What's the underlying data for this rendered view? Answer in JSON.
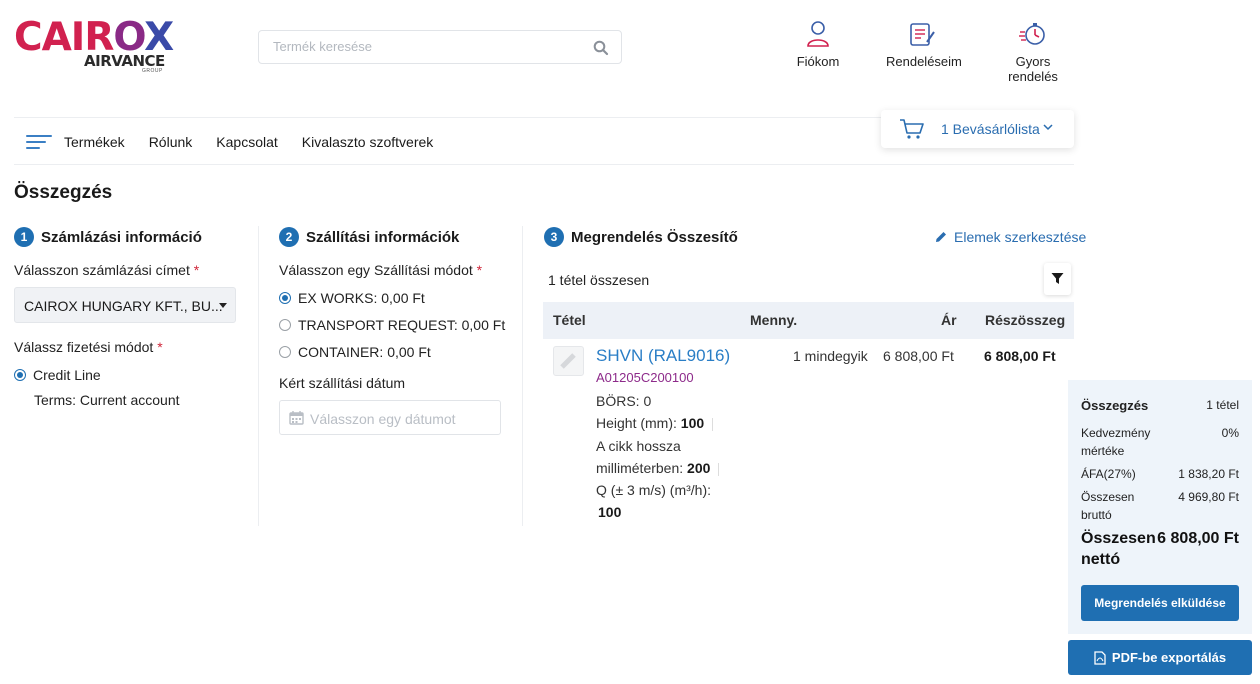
{
  "brand": {
    "name_part1": "CAIR",
    "name_part2": "O",
    "name_part3": "X",
    "sub": "AIRVANCE",
    "group": "GROUP"
  },
  "search": {
    "placeholder": "Termék keresése"
  },
  "header_links": {
    "account": "Fiókom",
    "orders": "Rendeléseim",
    "quick_order": "Gyors rendelés"
  },
  "nav": {
    "items": [
      "Termékek",
      "Rólunk",
      "Kapcsolat",
      "Kivalaszto szoftverek"
    ]
  },
  "cart": {
    "label": "1 Bevásárlólista"
  },
  "page_title": "Összegzés",
  "billing": {
    "step": "1",
    "title": "Számlázási információ",
    "address_label": "Válasszon számlázási címet",
    "address_value": "CAIROX HUNGARY KFT., BU...",
    "payment_label": "Válassz fizetési módot",
    "payment_option": "Credit Line",
    "payment_terms": "Terms: Current account"
  },
  "shipping": {
    "step": "2",
    "title": "Szállítási információk",
    "method_label": "Válasszon egy Szállítási módot",
    "options": [
      "EX WORKS: 0,00 Ft",
      "TRANSPORT REQUEST: 0,00 Ft",
      "CONTAINER: 0,00 Ft"
    ],
    "selected_index": 0,
    "date_label": "Kért szállítási dátum",
    "date_placeholder": "Válasszon egy dátumot"
  },
  "order": {
    "step": "3",
    "title": "Megrendelés Összesítő",
    "edit_link": "Elemek szerkesztése",
    "count_text": "1 tétel összesen",
    "columns": {
      "item": "Tétel",
      "qty": "Menny.",
      "price": "Ár",
      "subtotal": "Részösszeg"
    },
    "items": [
      {
        "name": "SHVN (RAL9016)",
        "code": "A01205C200100",
        "attr1": "BÖRS: 0",
        "attr2_label": "Height (mm):",
        "attr2_value": "100",
        "attr3_label_a": "A cikk hossza",
        "attr3_label_b": "milliméterben:",
        "attr3_value": "200",
        "attr4_label": "Q (± 3 m/s) (m³/h):",
        "attr4_value": "100",
        "qty": "1 mindegyik",
        "price": "6 808,00 Ft",
        "subtotal": "6 808,00 Ft"
      }
    ]
  },
  "summary": {
    "title": "Összegzés",
    "count": "1 tétel",
    "discount_label_a": "Kedvezmény",
    "discount_label_b": "mértéke",
    "discount_value": "0%",
    "vat_label": "ÁFA(27%)",
    "vat_value": "1 838,20 Ft",
    "gross_label_a": "Összesen",
    "gross_label_b": "bruttó",
    "gross_value": "4 969,80 Ft",
    "net_label_a": "Összesen",
    "net_label_b": "nettó",
    "net_value": "6 808,00 Ft",
    "submit_button": "Megrendelés elküldése",
    "pdf_button": "PDF-be exportálás"
  },
  "colors": {
    "primary": "#1f6fb2",
    "link": "#2a6db0",
    "brand_red": "#d1214f",
    "code_purple": "#8d2a8a"
  }
}
